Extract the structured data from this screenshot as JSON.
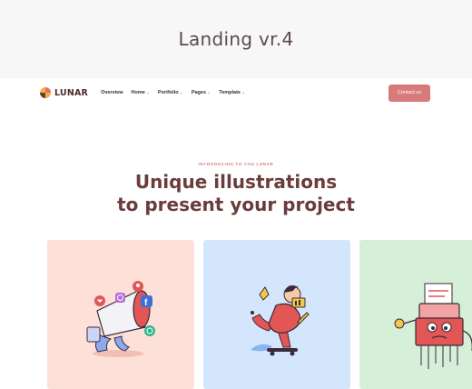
{
  "banner": {
    "title": "Landing vr.4"
  },
  "header": {
    "logo_text": "LUNAR",
    "menu": [
      {
        "label": "Overview",
        "has_dropdown": false
      },
      {
        "label": "Home",
        "has_dropdown": true
      },
      {
        "label": "Portfolio",
        "has_dropdown": true
      },
      {
        "label": "Pages",
        "has_dropdown": true
      },
      {
        "label": "Template",
        "has_dropdown": true
      }
    ],
    "cta_label": "Contact us"
  },
  "hero": {
    "eyebrow": "INTRODUCING TO YOU LUNAR",
    "headline_line1": "Unique illustrations",
    "headline_line2": "to present your project"
  },
  "cards": [
    {
      "illustration": "megaphone-social-icons",
      "background": "#fde0d8"
    },
    {
      "illustration": "skateboarder",
      "background": "#d4e6fb"
    },
    {
      "illustration": "paper-shredder-character",
      "background": "#d6efd8"
    }
  ],
  "colors": {
    "accent": "#d97a7a",
    "heading": "#6b3c3c"
  }
}
